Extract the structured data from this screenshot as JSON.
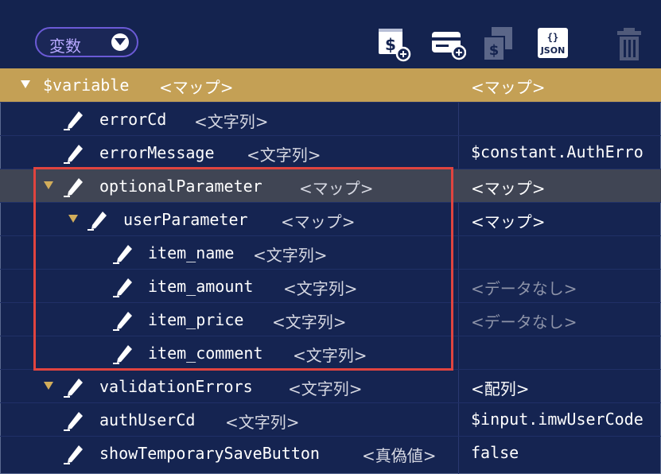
{
  "toolbar": {
    "variable_select_label": "変数",
    "buttons": [
      {
        "icon": "dollar-add-icon"
      },
      {
        "icon": "card-add-icon"
      },
      {
        "icon": "dollar-copy-icon"
      },
      {
        "icon": "json-icon",
        "label": "JSON"
      },
      {
        "icon": "trash-icon"
      }
    ]
  },
  "rows": [
    {
      "name": "$variable",
      "type": "<マップ>",
      "value": "<マップ>"
    },
    {
      "name": "errorCd",
      "type": "<文字列>",
      "value": ""
    },
    {
      "name": "errorMessage",
      "type": "<文字列>",
      "value": "$constant.AuthErro"
    },
    {
      "name": "optionalParameter",
      "type": "<マップ>",
      "value": "<マップ>"
    },
    {
      "name": "userParameter",
      "type": "<マップ>",
      "value": "<マップ>"
    },
    {
      "name": "item_name",
      "type": "<文字列>",
      "value": ""
    },
    {
      "name": "item_amount",
      "type": "<文字列>",
      "value": "<データなし>"
    },
    {
      "name": "item_price",
      "type": "<文字列>",
      "value": "<データなし>"
    },
    {
      "name": "item_comment",
      "type": "<文字列>",
      "value": ""
    },
    {
      "name": "validationErrors",
      "type": "<文字列>",
      "value": "<配列>"
    },
    {
      "name": "authUserCd",
      "type": "<文字列>",
      "value": "$input.imwUserCode"
    },
    {
      "name": "showTemporarySaveButton",
      "type": "<真偽値>",
      "value": "false"
    }
  ],
  "colors": {
    "background": "#152451",
    "root_row": "#c4a055",
    "selected_row": "#404554",
    "highlight_border": "#e0443f",
    "select_border": "#6b5ad6"
  }
}
